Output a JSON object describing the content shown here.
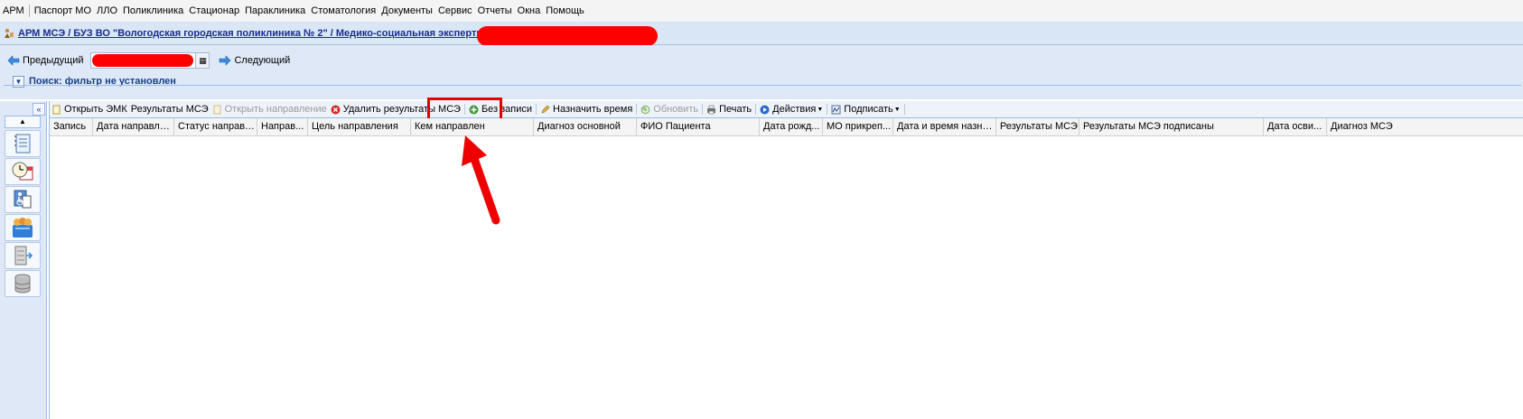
{
  "menu": {
    "items": [
      "АРМ",
      "Паспорт МО",
      "ЛЛО",
      "Поликлиника",
      "Стационар",
      "Параклиника",
      "Стоматология",
      "Документы",
      "Сервис",
      "Отчеты",
      "Окна",
      "Помощь"
    ]
  },
  "breadcrumb": {
    "text": "АРМ МСЭ / БУЗ ВО \"Вологодская городская поликлиника № 2\" / Медико-социальная экспертиза"
  },
  "nav": {
    "prev_label": "Предыдущий",
    "next_label": "Следующий"
  },
  "filter": {
    "label": "Поиск: фильтр не установлен"
  },
  "toolbar": {
    "open_emk": "Открыть ЭМК",
    "results_mse": "Результаты МСЭ",
    "open_referral": "Открыть направление",
    "delete_results": "Удалить результаты МСЭ",
    "without_record": "Без записи",
    "assign_time": "Назначить время",
    "refresh": "Обновить",
    "print": "Печать",
    "actions": "Действия",
    "sign": "Подписать"
  },
  "grid": {
    "columns": [
      "Запись",
      "Дата направле...",
      "Статус направл...",
      "Направ...",
      "Цель направления",
      "Кем направлен",
      "Диагноз основной",
      "ФИО Пациента",
      "Дата рожд...",
      "МО прикреп...",
      "Дата и время назнач...",
      "Результаты МСЭ",
      "Результаты МСЭ подписаны",
      "Дата осви...",
      "Диагноз МСЭ"
    ],
    "rows": []
  },
  "colors": {
    "accent_highlight": "#e00000",
    "redaction": "#ff0000",
    "panel_blue": "#dfe8f6",
    "link": "#1a2d8f"
  }
}
